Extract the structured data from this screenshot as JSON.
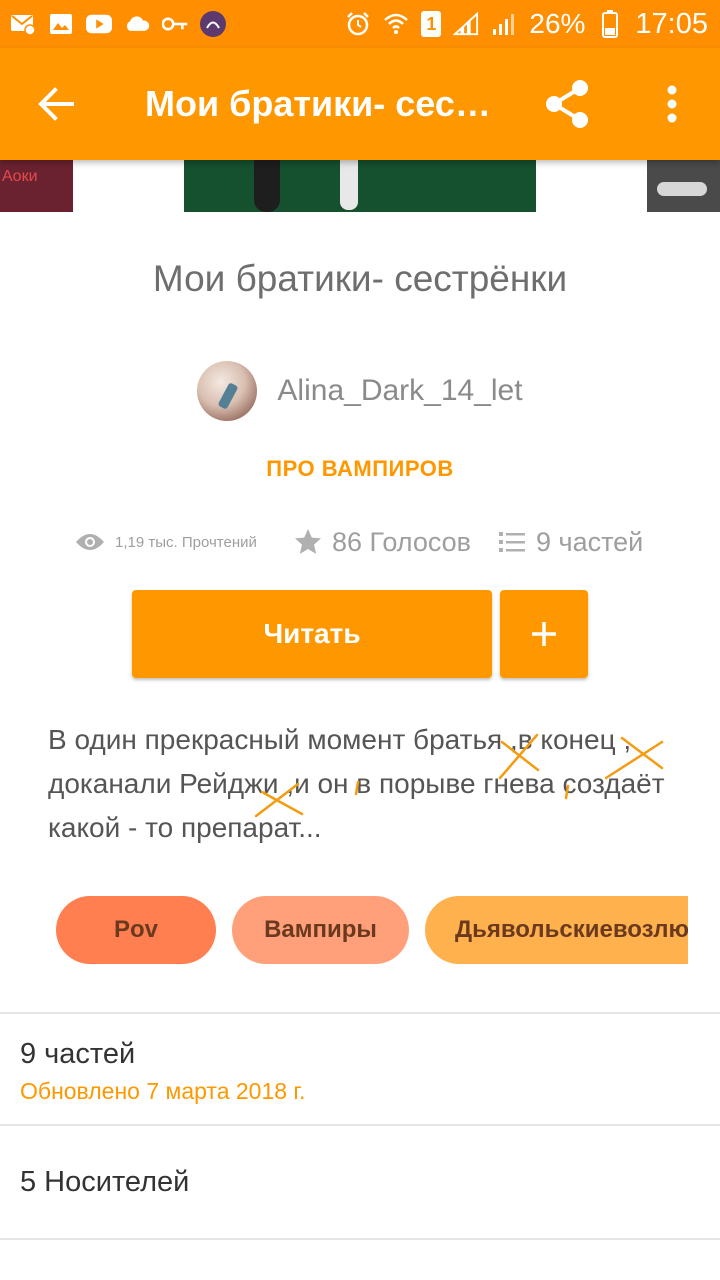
{
  "status_bar": {
    "battery_percent": "26%",
    "time": "17:05",
    "sim_badge": "1"
  },
  "app_bar": {
    "title": "Мои братики- сестрёнки"
  },
  "covers": {
    "left_cover_text": "Аоки"
  },
  "story": {
    "title": "Мои братики- сестрёнки",
    "author": "Alina_Dark_14_let",
    "category": "ПРО ВАМПИРОВ",
    "reads": "1,19 тыс. Прочтений",
    "votes": "86 Голосов",
    "parts": "9 частей",
    "read_button": "Читать",
    "add_button": "+",
    "description": "В один прекрасный момент братья ,в конец , доканали Рейджи ,и он в порыве гнева создаёт какой - то препарат..."
  },
  "tags": [
    "Pov",
    "Вампиры",
    "Дьявольскиевозлюбленные"
  ],
  "parts_row": {
    "title": "9 частей",
    "updated": "Обновлено 7 марта 2018 г."
  },
  "carriers_row": {
    "title": "5 Носителей"
  },
  "colors": {
    "status_bar": "#ff8f00",
    "app_bar": "#ff9800",
    "accent": "#ff9800",
    "annotation_marks": "#f39c12"
  }
}
